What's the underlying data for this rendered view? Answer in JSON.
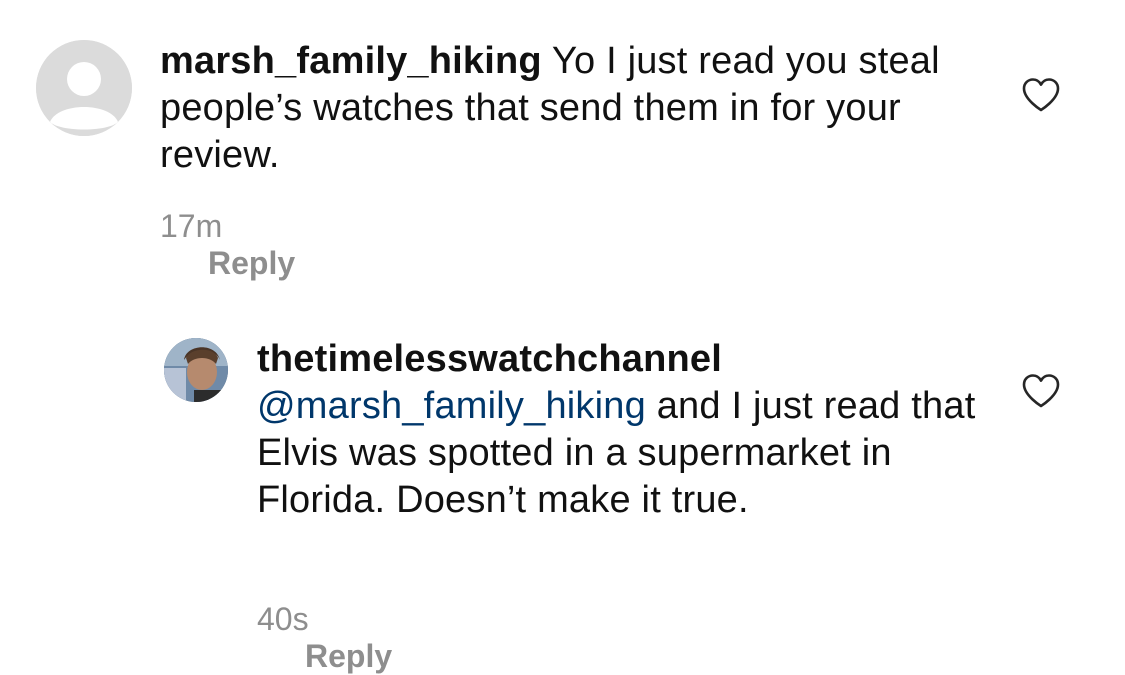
{
  "comments": [
    {
      "username": "marsh_family_hiking",
      "text": " Yo I just read you steal people’s watches that send them in for your review.",
      "time": "17m",
      "reply_label": "Reply",
      "avatar_icon": "default-avatar-icon",
      "like_icon": "heart-outline-icon"
    },
    {
      "username": "thetimelesswatchchannel",
      "mention": "@marsh_family_hiking",
      "text": " and I just read that Elvis was spotted in a supermarket in Florida. Doesn’t make it true.",
      "time": "40s",
      "reply_label": "Reply",
      "avatar_icon": "profile-photo-avatar",
      "like_icon": "heart-outline-icon"
    }
  ],
  "colors": {
    "text": "#111111",
    "secondary": "#8e8e8e",
    "mention": "#00376b",
    "placeholder_avatar": "#dbdbdb"
  }
}
